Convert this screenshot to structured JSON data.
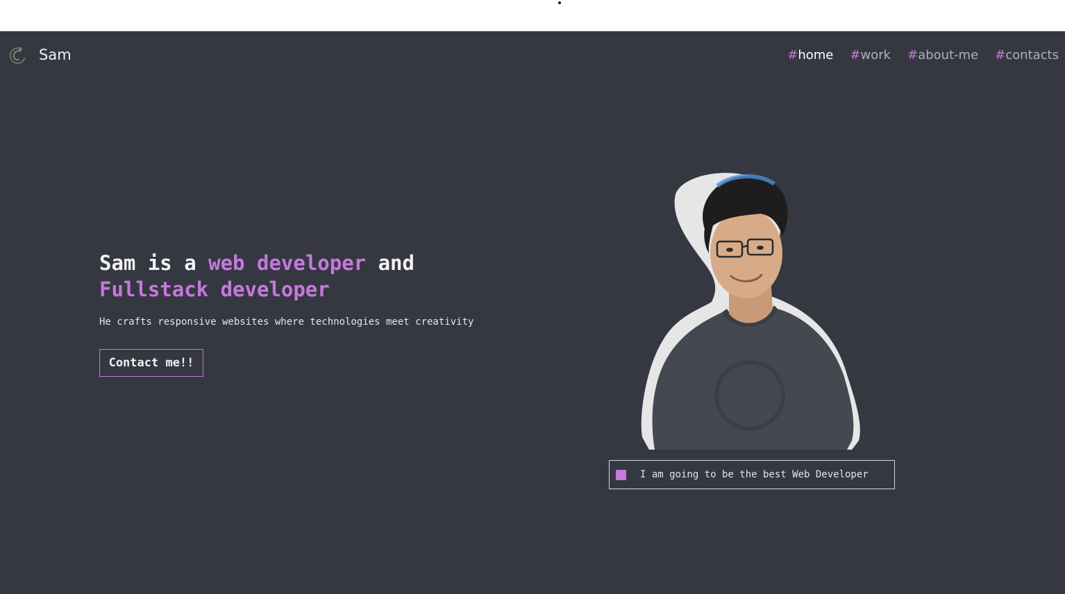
{
  "header": {
    "logo_name": "Sam"
  },
  "nav": {
    "items": [
      {
        "hash": "#",
        "label": "home",
        "active": true
      },
      {
        "hash": "#",
        "label": "work",
        "active": false
      },
      {
        "hash": "#",
        "label": "about-me",
        "active": false
      },
      {
        "hash": "#",
        "label": "contacts",
        "active": false
      }
    ]
  },
  "hero": {
    "title_part1": "Sam is a ",
    "title_accent1": "web developer",
    "title_part2": " and",
    "title_accent2": "Fullstack developer",
    "subtitle": "He crafts responsive websites where technologies meet creativity",
    "cta_label": "Contact me!!"
  },
  "status": {
    "text": "I am going to be the best Web Developer"
  },
  "colors": {
    "background": "#353841",
    "accent": "#c778dd",
    "text": "#e6e6e6"
  },
  "icons": [
    "logo-icon",
    "square-icon"
  ]
}
